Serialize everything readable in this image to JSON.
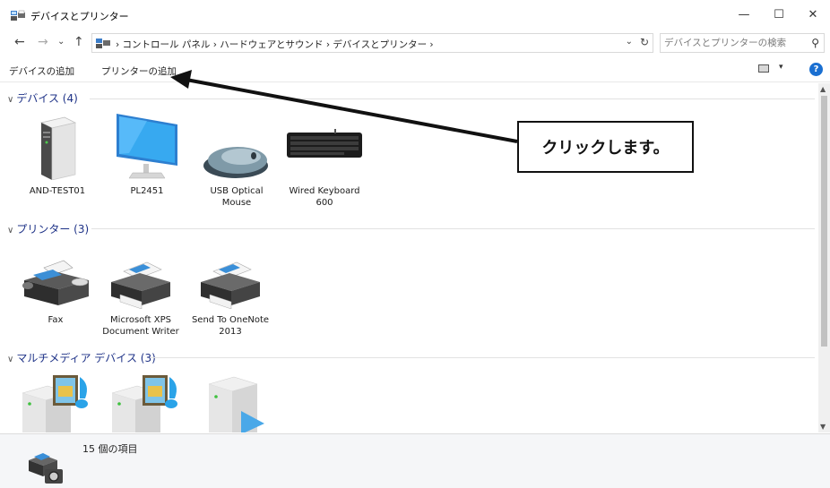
{
  "window": {
    "title": "デバイスとプリンター",
    "minimize_glyph": "—",
    "maximize_glyph": "☐",
    "close_glyph": "✕"
  },
  "nav": {
    "back_glyph": "←",
    "forward_glyph": "→",
    "recent_glyph": "⌄",
    "up_glyph": "↑"
  },
  "address": {
    "breadcrumbs": [
      "コントロール パネル",
      "ハードウェアとサウンド",
      "デバイスとプリンター"
    ],
    "separator": "›",
    "path_text": "› コントロール パネル › ハードウェアとサウンド › デバイスとプリンター ›",
    "dropdown_glyph": "⌄",
    "refresh_glyph": "↻"
  },
  "search": {
    "placeholder": "デバイスとプリンターの検索",
    "icon": "search-icon"
  },
  "commands": {
    "add_device": "デバイスの追加",
    "add_printer": "プリンターの追加",
    "view_dropdown_glyph": "▾",
    "help_glyph": "?"
  },
  "groups": [
    {
      "title": "デバイス (4)",
      "items": [
        {
          "label": "AND-TEST01",
          "icon": "computer-tower-icon"
        },
        {
          "label": "PL2451",
          "icon": "monitor-icon"
        },
        {
          "label": "USB Optical Mouse",
          "icon": "mouse-icon"
        },
        {
          "label": "Wired Keyboard 600",
          "icon": "keyboard-icon"
        }
      ]
    },
    {
      "title": "プリンター (3)",
      "items": [
        {
          "label": "Fax",
          "icon": "fax-icon"
        },
        {
          "label": "Microsoft XPS Document Writer",
          "icon": "printer-icon"
        },
        {
          "label": "Send To OneNote 2013",
          "icon": "printer-icon"
        }
      ]
    },
    {
      "title": "マルチメディア デバイス (3)",
      "items": [
        {
          "label": "",
          "icon": "media-server-icon"
        },
        {
          "label": "",
          "icon": "media-server-icon"
        },
        {
          "label": "",
          "icon": "media-device-icon"
        }
      ]
    }
  ],
  "details": {
    "item_count": "15 個の項目"
  },
  "annotation": {
    "callout_text": "クリックします。"
  },
  "colors": {
    "group_header": "#1e3287",
    "help_button": "#1a6fd1",
    "details_background": "#f5f6f8"
  }
}
